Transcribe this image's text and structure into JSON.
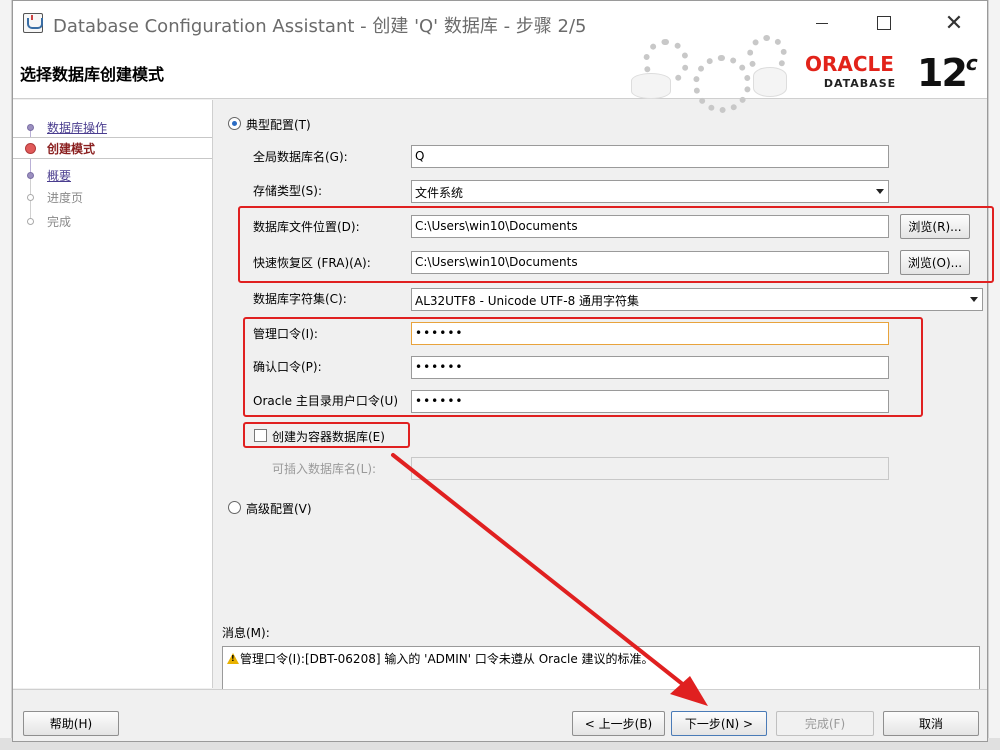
{
  "window": {
    "title": "Database Configuration Assistant - 创建 'Q' 数据库 - 步骤 2/5"
  },
  "header": {
    "title": "选择数据库创建模式",
    "oracle_word": "ORACLE",
    "oracle_sub": "DATABASE",
    "version": "12",
    "version_sup": "c"
  },
  "sidebar": {
    "steps": [
      {
        "label": "数据库操作",
        "state": "done"
      },
      {
        "label": "创建模式",
        "state": "current"
      },
      {
        "label": "概要",
        "state": "done"
      },
      {
        "label": "进度页",
        "state": "future"
      },
      {
        "label": "完成",
        "state": "future"
      }
    ]
  },
  "form": {
    "typical_label": "典型配置(T)",
    "global_db_name_label": "全局数据库名(G):",
    "global_db_name_value": "Q",
    "storage_type_label": "存储类型(S):",
    "storage_type_value": "文件系统",
    "db_file_location_label": "数据库文件位置(D):",
    "db_file_location_value": "C:\\Users\\win10\\Documents",
    "browse1_label": "浏览(R)...",
    "fra_label": "快速恢复区 (FRA)(A):",
    "fra_value": "C:\\Users\\win10\\Documents",
    "browse2_label": "浏览(O)...",
    "charset_label": "数据库字符集(C):",
    "charset_value": "AL32UTF8 - Unicode UTF-8 通用字符集",
    "admin_pw_label": "管理口令(I):",
    "admin_pw_value": "••••••",
    "confirm_pw_label": "确认口令(P):",
    "confirm_pw_value": "••••••",
    "home_user_pw_label": "Oracle 主目录用户口令(U)",
    "home_user_pw_value": "••••••",
    "container_label": "创建为容器数据库(E)",
    "pluggable_label": "可插入数据库名(L):",
    "pluggable_value": "",
    "advanced_label": "高级配置(V)"
  },
  "messages": {
    "label": "消息(M):",
    "text": "管理口令(I):[DBT-06208] 输入的 'ADMIN' 口令未遵从 Oracle 建议的标准。"
  },
  "footer": {
    "help_label": "帮助(H)",
    "back_label": "< 上一步(B)",
    "next_label": "下一步(N) >",
    "finish_label": "完成(F)",
    "cancel_label": "取消"
  },
  "colors": {
    "annotation_red": "#e02020",
    "oracle_red": "#e2231a",
    "focus_border": "#e8a33c",
    "radio_accent": "#2b6cc4"
  }
}
